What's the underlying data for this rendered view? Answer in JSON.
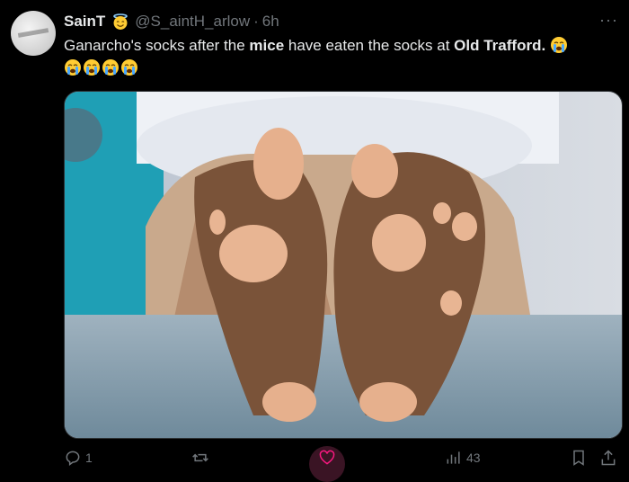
{
  "tweet": {
    "display_name": "SainT",
    "handle": "@S_aintH_arlow",
    "separator": "·",
    "time": "6h",
    "text_parts": {
      "t1": "Ganarcho's socks after the ",
      "t2": "mice",
      "t3": " have eaten the socks at ",
      "t4": "Old Trafford."
    },
    "more_icon": "more-icon"
  },
  "actions": {
    "replies": "1",
    "retweets": "",
    "views": "43"
  },
  "colors": {
    "background": "#000000",
    "text": "#e7e9ea",
    "muted": "#71767b",
    "like_active": "#f91880"
  }
}
